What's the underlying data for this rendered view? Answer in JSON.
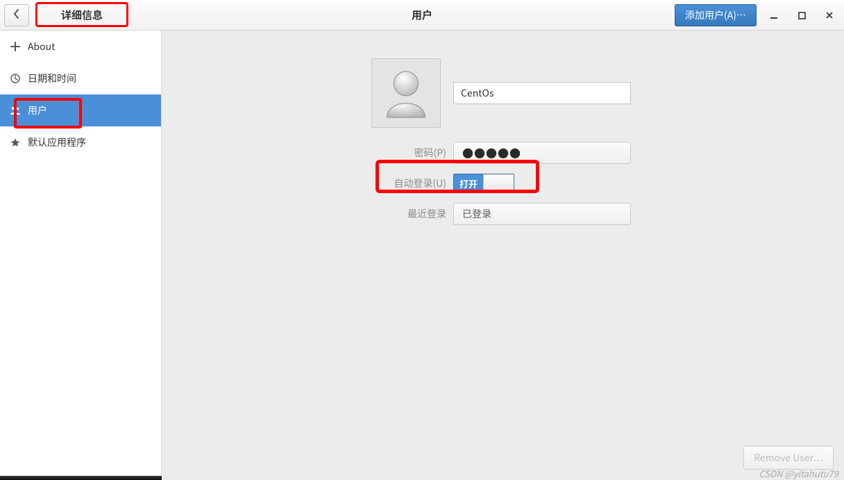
{
  "header": {
    "details_title": "详细信息",
    "window_title": "用户",
    "add_user_label": "添加用户(A)…"
  },
  "sidebar": {
    "items": [
      {
        "label": "About"
      },
      {
        "label": "日期和时间"
      },
      {
        "label": "用户"
      },
      {
        "label": "默认应用程序"
      }
    ]
  },
  "profile": {
    "name_value": "CentOs"
  },
  "form": {
    "password_label": "密码(P)",
    "password_value": "●●●●●",
    "autologin_label": "自动登录(U)",
    "autologin_toggle": "打开",
    "recent_label": "最近登录",
    "recent_value": "已登录"
  },
  "footer": {
    "remove_user_label": "Remove User…"
  },
  "watermark": "CSDN @yitahutu79"
}
